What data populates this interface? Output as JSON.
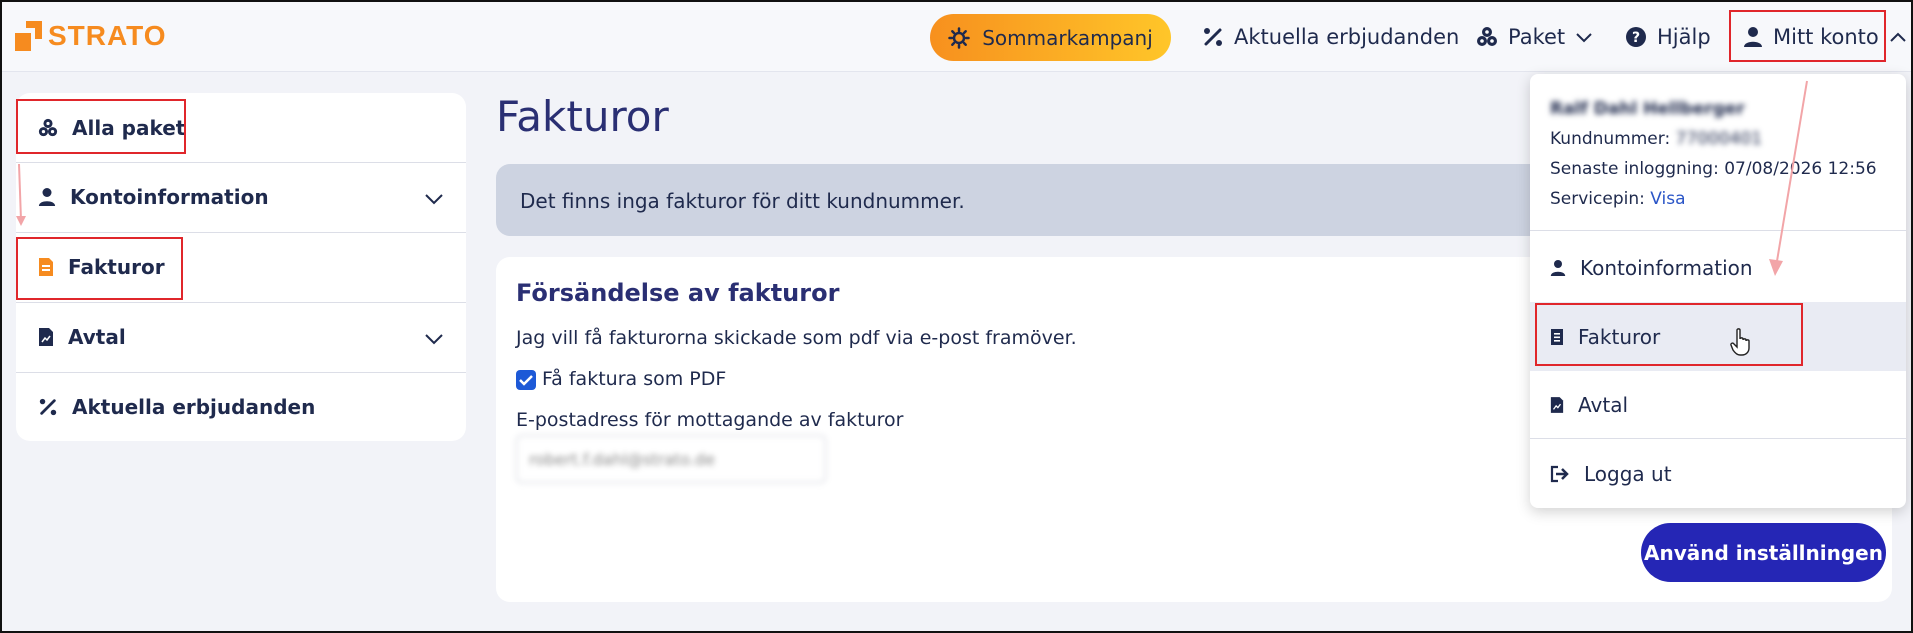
{
  "brand": {
    "logo_text": "STRATO",
    "accent": "#f68b1f",
    "primary": "#2526b5"
  },
  "header": {
    "promo_label": "Sommarkampanj",
    "offers_label": "Aktuella erbjudanden",
    "packages_label": "Paket",
    "help_label": "Hjälp",
    "account_label": "Mitt konto"
  },
  "sidebar": {
    "items": [
      {
        "label": "Alla paket",
        "icon": "cubes-icon"
      },
      {
        "label": "Kontoinformation",
        "icon": "user-icon"
      },
      {
        "label": "Fakturor",
        "icon": "invoice-icon"
      },
      {
        "label": "Avtal",
        "icon": "contract-icon"
      },
      {
        "label": "Aktuella erbjudanden",
        "icon": "percent-icon"
      }
    ]
  },
  "main": {
    "title": "Fakturor",
    "notice": "Det finns inga fakturor för ditt kundnummer.",
    "card": {
      "heading": "Försändelse av fakturor",
      "description": "Jag vill få fakturorna skickade som pdf via e-post framöver.",
      "checkbox_label": "Få faktura som PDF",
      "email_label": "E-postadress för mottagande av fakturor",
      "email_value": "robert.f.dahl@strato.de",
      "apply_label": "Använd inställningen"
    }
  },
  "account_menu": {
    "name": "Ralf Dahl Hellberger",
    "customer_label": "Kundnummer:",
    "customer_value": "77000401",
    "last_login_label": "Senaste inloggning:",
    "last_login_value": "07/08/2026 12:56",
    "servicepin_label": "Servicepin:",
    "servicepin_link": "Visa",
    "items": [
      {
        "label": "Kontoinformation",
        "icon": "user-icon"
      },
      {
        "label": "Fakturor",
        "icon": "invoice-icon"
      },
      {
        "label": "Avtal",
        "icon": "contract-icon"
      },
      {
        "label": "Logga ut",
        "icon": "logout-icon"
      }
    ]
  }
}
